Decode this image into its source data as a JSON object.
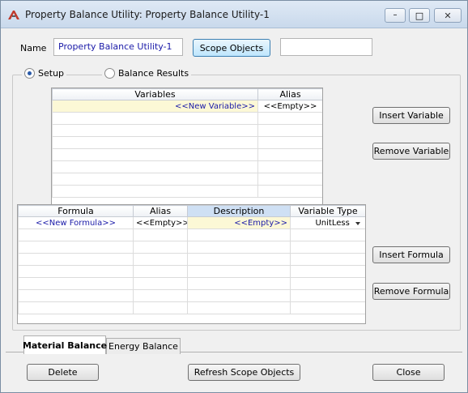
{
  "window": {
    "title": "Property Balance Utility: Property Balance Utility-1",
    "minimize_glyph": "–",
    "maximize_glyph": "□",
    "close_glyph": "✕"
  },
  "name_row": {
    "label": "Name",
    "value": "Property Balance Utility-1",
    "scope_button": "Scope Objects",
    "scope_value": ""
  },
  "mode": {
    "setup_label": "Setup",
    "results_label": "Balance Results",
    "selected": "Setup"
  },
  "variables_table": {
    "headers": [
      "Variables",
      "Alias"
    ],
    "rows": [
      [
        "<<New Variable>>",
        "<<Empty>>"
      ]
    ],
    "empty_rows": 7
  },
  "variable_buttons": {
    "insert": "Insert Variable",
    "remove": "Remove Variable"
  },
  "formula_table": {
    "headers": [
      "Formula",
      "Alias",
      "Description",
      "Variable Type"
    ],
    "rows": [
      [
        "<<New Formula>>",
        "<<Empty>>",
        "<<Empty>>",
        "UnitLess"
      ]
    ],
    "empty_rows": 7
  },
  "formula_buttons": {
    "insert": "Insert Formula",
    "remove": "Remove Formula"
  },
  "tabs": [
    {
      "label": "Material Balance",
      "active": true
    },
    {
      "label": "Energy Balance",
      "active": false
    }
  ],
  "footer": {
    "delete": "Delete",
    "refresh": "Refresh Scope Objects",
    "close": "Close"
  },
  "colors": {
    "highlight_row": "#fcf8d6",
    "value_text": "#1a1aa8",
    "selected_header": "#cfe0f4"
  }
}
